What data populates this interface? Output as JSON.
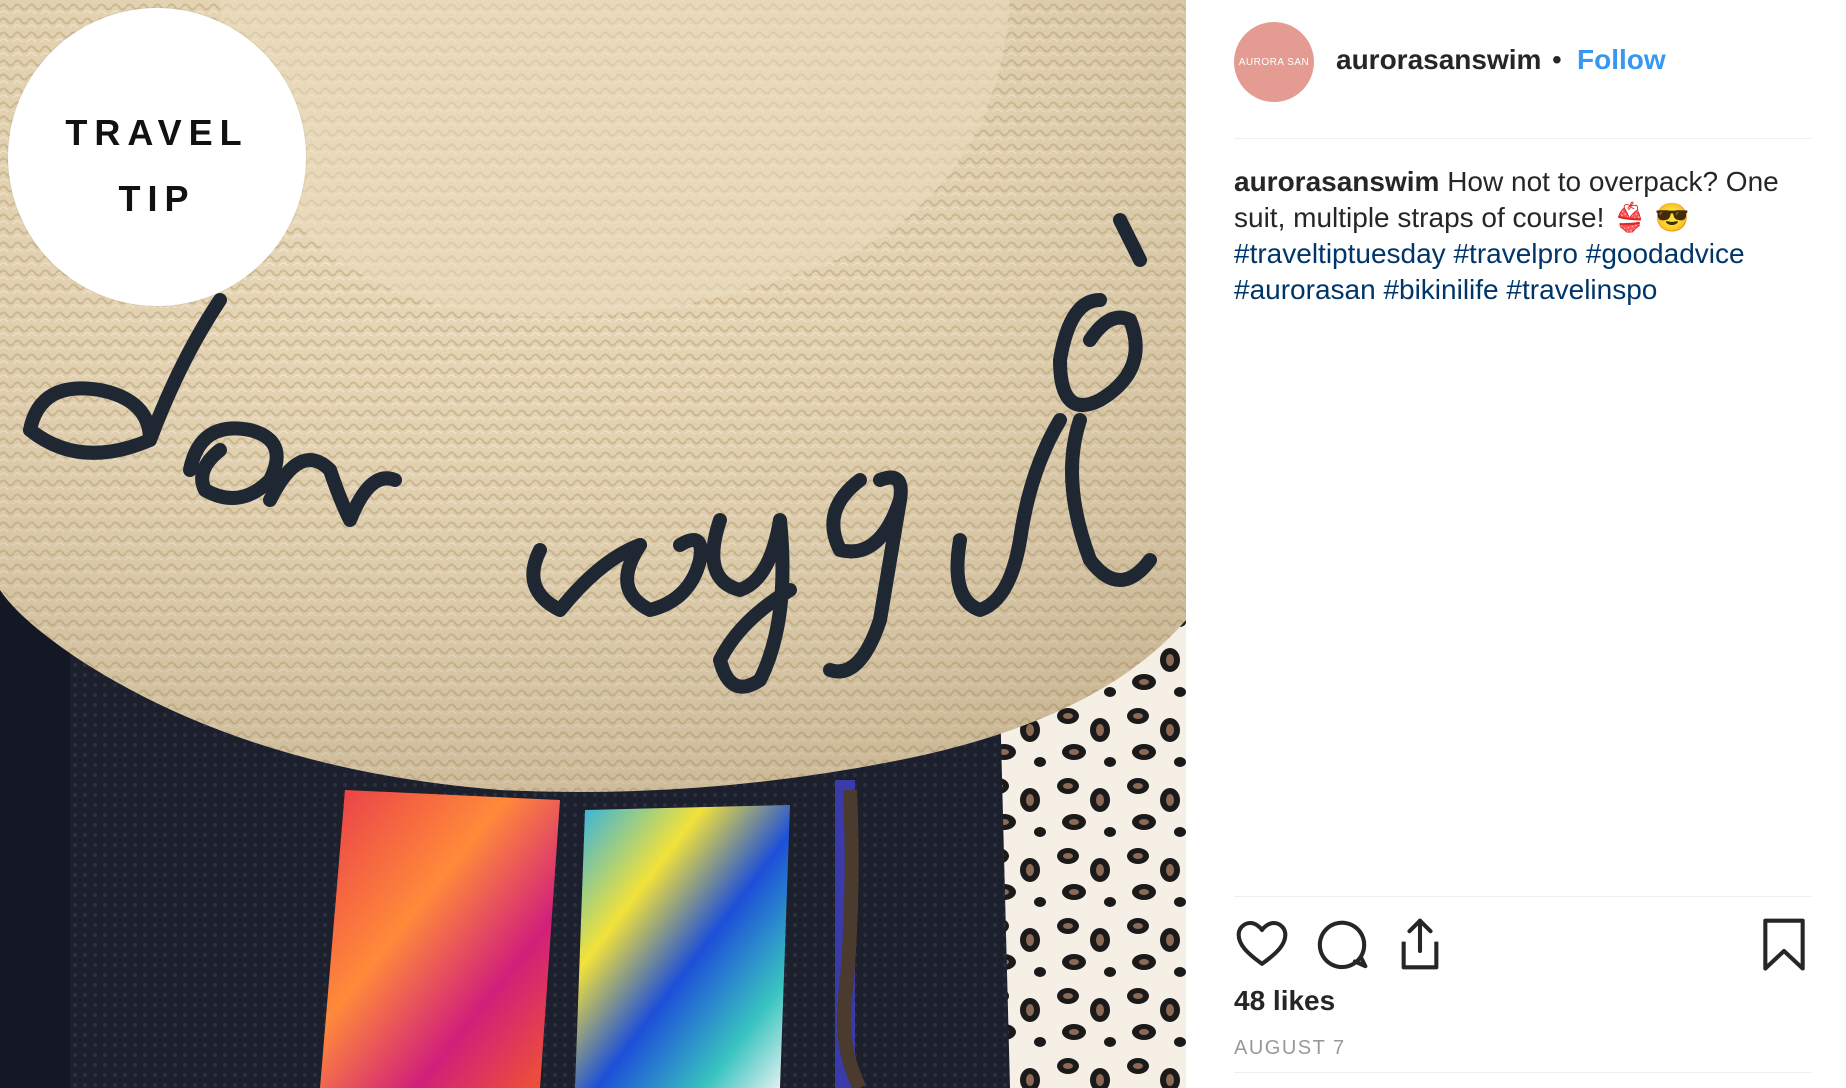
{
  "photo": {
    "badge_line1": "TRAVEL",
    "badge_line2": "TIP",
    "hat_text": "bon voyage"
  },
  "header": {
    "username": "aurorasanswim",
    "separator": "•",
    "follow_label": "Follow",
    "avatar_text": "AURORA SAN"
  },
  "caption": {
    "username": "aurorasanswim",
    "text": "How not to overpack? One suit, multiple straps of course! 👙 😎",
    "hashtags": [
      "#traveltiptuesday",
      "#travelpro",
      "#goodadvice",
      "#aurorasan",
      "#bikinilife",
      "#travelinspo"
    ]
  },
  "actions": {
    "like_icon": "heart-icon",
    "comment_icon": "comment-icon",
    "share_icon": "share-icon",
    "save_icon": "bookmark-icon"
  },
  "likes_text": "48 likes",
  "date_text": "AUGUST 7",
  "colors": {
    "follow": "#3897f0",
    "hashtag": "#003569",
    "avatar_bg": "#e39b92",
    "text": "#262626",
    "muted": "#999999"
  }
}
